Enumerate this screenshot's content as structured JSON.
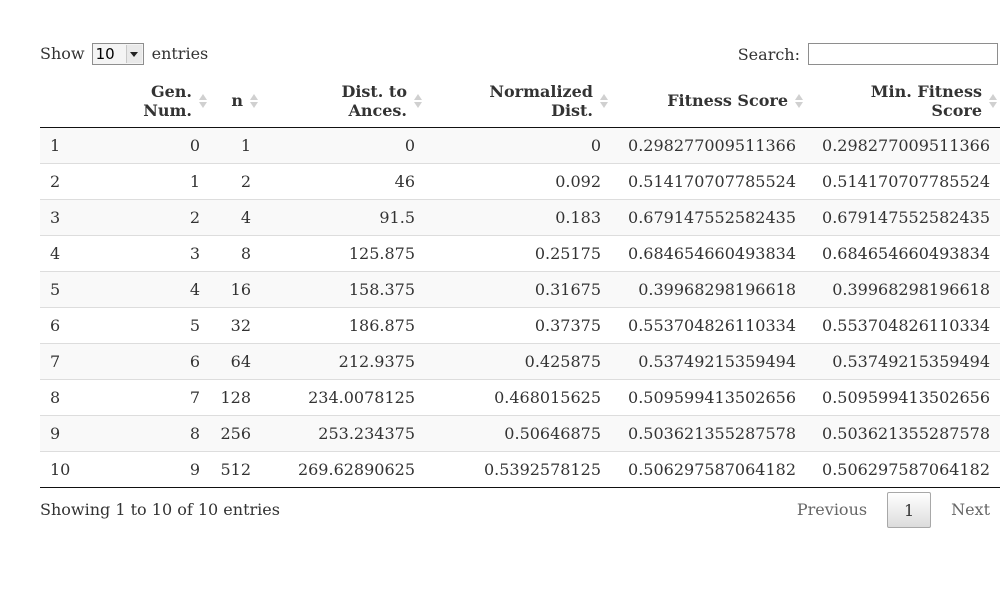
{
  "length_menu": {
    "prefix": "Show",
    "selected": "10",
    "suffix": "entries"
  },
  "search": {
    "label": "Search:",
    "value": ""
  },
  "table": {
    "columns": [
      {
        "line1": "",
        "line2": ""
      },
      {
        "line1": "Gen.",
        "line2": "Num."
      },
      {
        "line1": "n",
        "line2": ""
      },
      {
        "line1": "Dist. to",
        "line2": "Ances."
      },
      {
        "line1": "Normalized",
        "line2": "Dist."
      },
      {
        "line1": "Fitness Score",
        "line2": ""
      },
      {
        "line1": "Min. Fitness",
        "line2": "Score"
      }
    ],
    "rows": [
      [
        "1",
        "0",
        "1",
        "0",
        "0",
        "0.298277009511366",
        "0.298277009511366"
      ],
      [
        "2",
        "1",
        "2",
        "46",
        "0.092",
        "0.514170707785524",
        "0.514170707785524"
      ],
      [
        "3",
        "2",
        "4",
        "91.5",
        "0.183",
        "0.679147552582435",
        "0.679147552582435"
      ],
      [
        "4",
        "3",
        "8",
        "125.875",
        "0.25175",
        "0.684654660493834",
        "0.684654660493834"
      ],
      [
        "5",
        "4",
        "16",
        "158.375",
        "0.31675",
        "0.39968298196618",
        "0.39968298196618"
      ],
      [
        "6",
        "5",
        "32",
        "186.875",
        "0.37375",
        "0.553704826110334",
        "0.553704826110334"
      ],
      [
        "7",
        "6",
        "64",
        "212.9375",
        "0.425875",
        "0.53749215359494",
        "0.53749215359494"
      ],
      [
        "8",
        "7",
        "128",
        "234.0078125",
        "0.468015625",
        "0.509599413502656",
        "0.509599413502656"
      ],
      [
        "9",
        "8",
        "256",
        "253.234375",
        "0.50646875",
        "0.503621355287578",
        "0.503621355287578"
      ],
      [
        "10",
        "9",
        "512",
        "269.62890625",
        "0.5392578125",
        "0.506297587064182",
        "0.506297587064182"
      ]
    ]
  },
  "info": "Showing 1 to 10 of 10 entries",
  "pagination": {
    "previous": "Previous",
    "current": "1",
    "next": "Next"
  }
}
